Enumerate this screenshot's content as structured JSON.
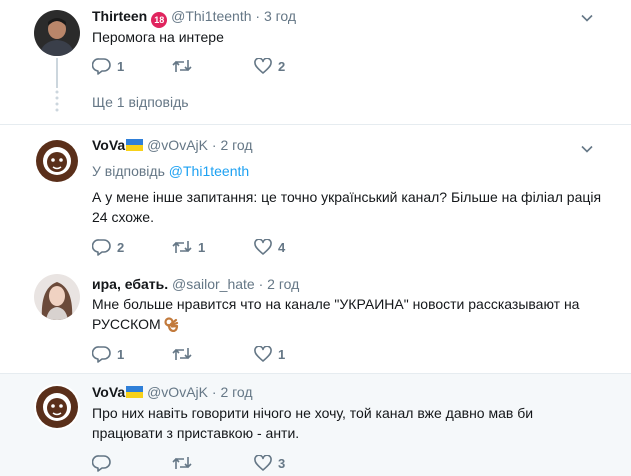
{
  "tweets": [
    {
      "name": "Thirteen",
      "handle": "@Thi1teenth",
      "time": "3 год",
      "dot": "·",
      "badge": "18",
      "text": "Перомога на интере",
      "replies": "1",
      "retweets": "",
      "likes": "2",
      "more_replies": "Ще 1 відповідь"
    },
    {
      "name": "VoVa",
      "handle": "@vOvAjK",
      "time": "2 год",
      "dot": "·",
      "reply_prefix": "У відповідь",
      "reply_to": "@Thi1teenth",
      "text_line1": "А у мене інше запитання: це точно український канал? Більше на філіал рація",
      "text_line2": "24 схоже.",
      "replies": "2",
      "retweets": "1",
      "likes": "4"
    },
    {
      "name": "ира, ебать.",
      "handle": "@sailor_hate",
      "time": "2 год",
      "dot": "·",
      "text_line1": "Мне больше нравится что на канале \"УКРАИНА\" новости рассказывают на",
      "text_line2": "РУССКОМ",
      "replies": "1",
      "retweets": "",
      "likes": "1"
    },
    {
      "name": "VoVa",
      "handle": "@vOvAjK",
      "time": "2 год",
      "dot": "·",
      "text_line1": "Про них навіть говорити нічого не хочу, той канал вже давно мав би",
      "text_line2": "працювати з приставкою - анти.",
      "replies": "",
      "retweets": "",
      "likes": "3"
    }
  ],
  "colors": {
    "text": "#14171a",
    "muted": "#657786",
    "link": "#1da1f2",
    "divider": "#e6ecf0",
    "thread": "#ccd6dd",
    "highlight_bg": "#f5f8fa"
  },
  "icons": [
    "reply-icon",
    "retweet-icon",
    "like-icon",
    "chevron-down-icon",
    "ua-flag-icon",
    "ok-hand-emoji-icon",
    "age-18-badge-icon"
  ]
}
